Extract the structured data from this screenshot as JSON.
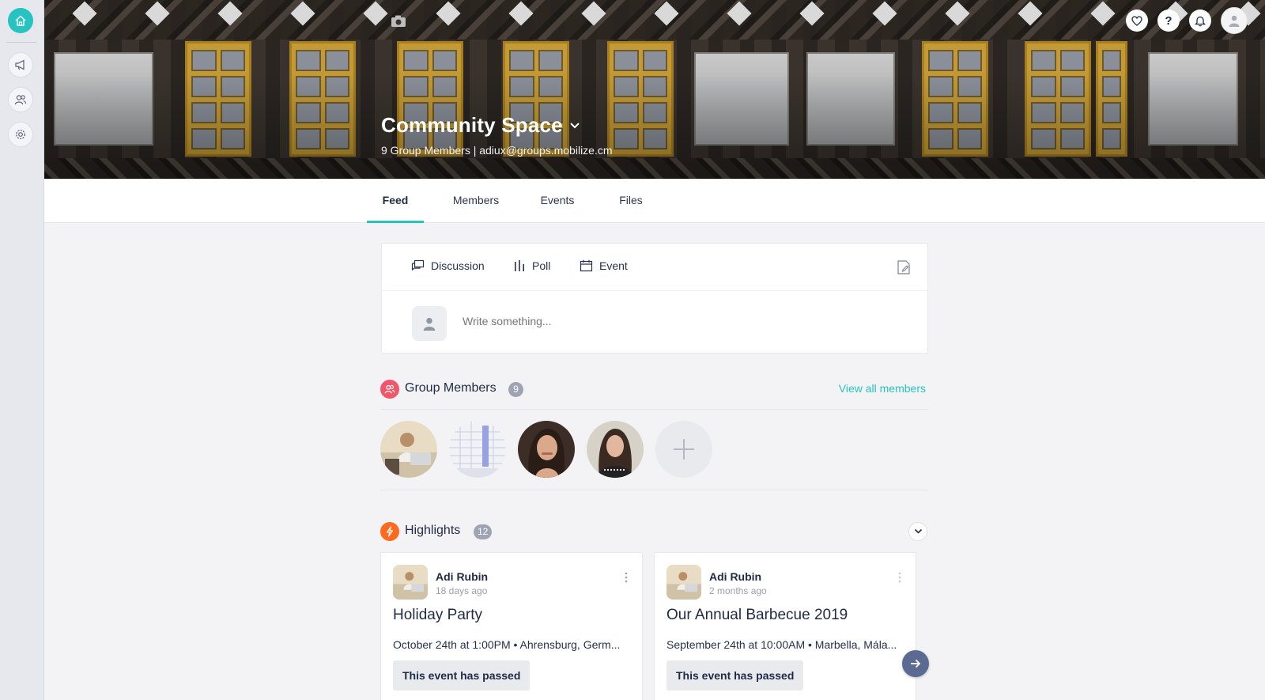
{
  "cover": {
    "title": "Community Space",
    "subtitle": "9 Group Members | adiux@groups.mobilize.cm"
  },
  "tabs": [
    {
      "label": "Feed",
      "active": true
    },
    {
      "label": "Members",
      "active": false
    },
    {
      "label": "Events",
      "active": false
    },
    {
      "label": "Files",
      "active": false
    }
  ],
  "composer": {
    "actions": [
      "Discussion",
      "Poll",
      "Event"
    ],
    "placeholder": "Write something..."
  },
  "group_members": {
    "title": "Group Members",
    "count": "9",
    "view_all": "View all members"
  },
  "highlights": {
    "title": "Highlights",
    "count": "12",
    "cards": [
      {
        "author": "Adi Rubin",
        "time": "18 days ago",
        "title": "Holiday Party",
        "meta": "October 24th at 1:00PM • Ahrensburg, Germ...",
        "status": "This event has passed"
      },
      {
        "author": "Adi Rubin",
        "time": "2 months ago",
        "title": "Our Annual Barbecue 2019",
        "meta": "September 24th at 10:00AM • Marbella, Mála...",
        "status": "This event has passed"
      }
    ]
  },
  "colors": {
    "accent": "#26c3c1",
    "members_icon": "#f0576b",
    "highlights_icon": "#ff6a1f",
    "next_button": "#5a6a91"
  },
  "icons": [
    "home-icon",
    "megaphone-icon",
    "people-icon",
    "gear-icon",
    "camera-icon",
    "heart-icon",
    "help-icon",
    "bell-icon",
    "user-avatar-icon",
    "chevron-down-icon",
    "discussion-icon",
    "poll-icon",
    "calendar-icon",
    "edit-icon",
    "plus-icon",
    "bolt-icon",
    "more-vertical-icon",
    "arrow-right-icon"
  ]
}
